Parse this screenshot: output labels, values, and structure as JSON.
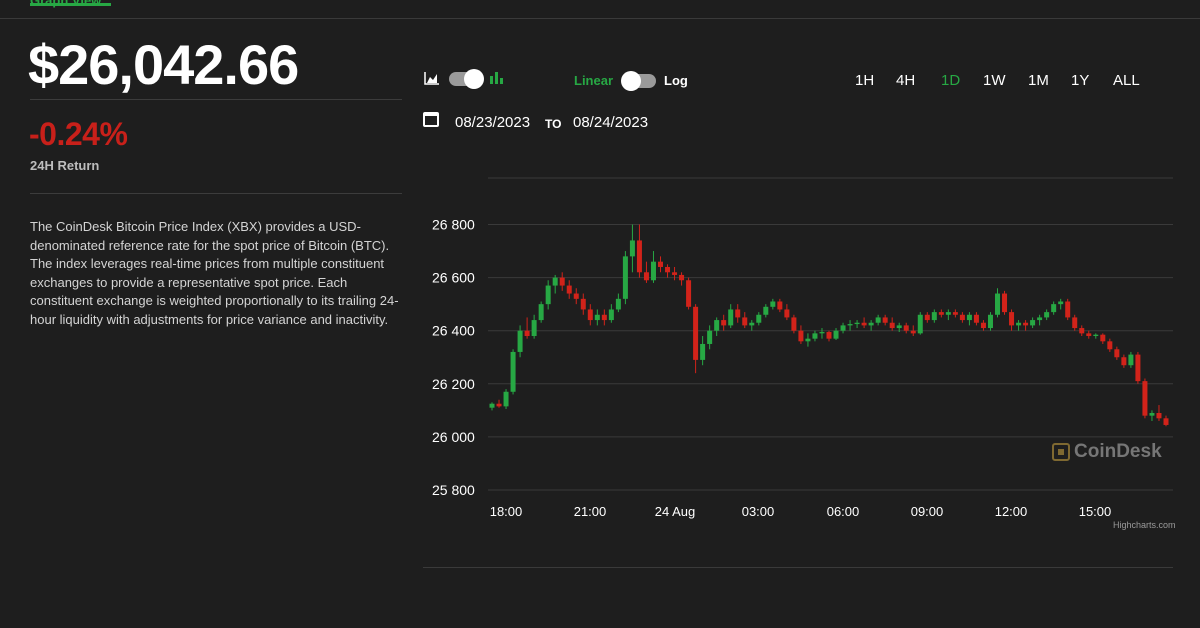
{
  "header": {
    "tab_label": "Graph View"
  },
  "summary": {
    "price": "$26,042.66",
    "change": "-0.24%",
    "change_label": "24H Return",
    "description": "The CoinDesk Bitcoin Price Index (XBX) provides a USD-denominated reference rate for the spot price of Bitcoin (BTC). The index leverages real-time prices from multiple constituent exchanges to provide a representative spot price. Each constituent exchange is weighted proportionally to its trailing 24-hour liquidity with adjustments for price variance and inactivity."
  },
  "controls": {
    "chart_style_icons": [
      "area-chart-icon",
      "candlestick-chart-icon"
    ],
    "scale_linear": "Linear",
    "scale_log": "Log",
    "ranges": [
      "1H",
      "4H",
      "1D",
      "1W",
      "1M",
      "1Y",
      "ALL"
    ],
    "active_range": "1D",
    "date_from": "08/23/2023",
    "date_to_label": "TO",
    "date_to": "08/24/2023"
  },
  "colors": {
    "up": "#27a844",
    "down": "#d2231a",
    "accent": "#27a844"
  },
  "chart_data": {
    "type": "candlestick",
    "x_ticks": [
      "18:00",
      "21:00",
      "24 Aug",
      "03:00",
      "06:00",
      "09:00",
      "12:00",
      "15:00"
    ],
    "y_ticks": [
      25800,
      26000,
      26200,
      26400,
      26600,
      26800
    ],
    "y_tick_labels": [
      "25 800",
      "26 000",
      "26 200",
      "26 400",
      "26 600",
      "26 800"
    ],
    "ylim": [
      25800,
      26850
    ],
    "grid": true,
    "credits": "Highcharts.com",
    "watermark": "CoinDesk",
    "candles": [
      [
        26110,
        26130,
        26100,
        26125
      ],
      [
        26125,
        26140,
        26110,
        26115
      ],
      [
        26115,
        26180,
        26105,
        26170
      ],
      [
        26170,
        26330,
        26160,
        26320
      ],
      [
        26320,
        26420,
        26300,
        26400
      ],
      [
        26400,
        26450,
        26370,
        26380
      ],
      [
        26380,
        26460,
        26370,
        26440
      ],
      [
        26440,
        26510,
        26430,
        26500
      ],
      [
        26500,
        26590,
        26480,
        26570
      ],
      [
        26570,
        26610,
        26540,
        26600
      ],
      [
        26600,
        26620,
        26550,
        26570
      ],
      [
        26570,
        26590,
        26520,
        26540
      ],
      [
        26540,
        26560,
        26500,
        26520
      ],
      [
        26520,
        26540,
        26460,
        26480
      ],
      [
        26480,
        26500,
        26420,
        26440
      ],
      [
        26440,
        26480,
        26420,
        26460
      ],
      [
        26460,
        26480,
        26420,
        26440
      ],
      [
        26440,
        26500,
        26430,
        26480
      ],
      [
        26480,
        26540,
        26470,
        26520
      ],
      [
        26520,
        26700,
        26500,
        26680
      ],
      [
        26680,
        26800,
        26620,
        26740
      ],
      [
        26740,
        26800,
        26600,
        26620
      ],
      [
        26620,
        26660,
        26580,
        26590
      ],
      [
        26590,
        26700,
        26580,
        26660
      ],
      [
        26660,
        26680,
        26620,
        26640
      ],
      [
        26640,
        26650,
        26600,
        26620
      ],
      [
        26620,
        26640,
        26590,
        26610
      ],
      [
        26610,
        26620,
        26570,
        26590
      ],
      [
        26590,
        26600,
        26480,
        26490
      ],
      [
        26490,
        26500,
        26240,
        26290
      ],
      [
        26290,
        26380,
        26270,
        26350
      ],
      [
        26350,
        26420,
        26330,
        26400
      ],
      [
        26400,
        26450,
        26380,
        26440
      ],
      [
        26440,
        26460,
        26400,
        26420
      ],
      [
        26420,
        26500,
        26410,
        26480
      ],
      [
        26480,
        26500,
        26430,
        26450
      ],
      [
        26450,
        26470,
        26410,
        26420
      ],
      [
        26420,
        26440,
        26400,
        26430
      ],
      [
        26430,
        26470,
        26420,
        26460
      ],
      [
        26460,
        26500,
        26450,
        26490
      ],
      [
        26490,
        26520,
        26480,
        26510
      ],
      [
        26510,
        26520,
        26470,
        26480
      ],
      [
        26480,
        26500,
        26440,
        26450
      ],
      [
        26450,
        26460,
        26390,
        26400
      ],
      [
        26400,
        26420,
        26350,
        26360
      ],
      [
        26360,
        26390,
        26340,
        26370
      ],
      [
        26370,
        26400,
        26360,
        26390
      ],
      [
        26390,
        26410,
        26370,
        26395
      ],
      [
        26395,
        26400,
        26360,
        26370
      ],
      [
        26370,
        26410,
        26365,
        26400
      ],
      [
        26400,
        26430,
        26390,
        26420
      ],
      [
        26420,
        26440,
        26400,
        26425
      ],
      [
        26425,
        26440,
        26410,
        26430
      ],
      [
        26430,
        26450,
        26410,
        26420
      ],
      [
        26420,
        26440,
        26400,
        26430
      ],
      [
        26430,
        26460,
        26420,
        26450
      ],
      [
        26450,
        26460,
        26420,
        26430
      ],
      [
        26430,
        26450,
        26400,
        26410
      ],
      [
        26410,
        26430,
        26395,
        26420
      ],
      [
        26420,
        26430,
        26390,
        26400
      ],
      [
        26400,
        26420,
        26380,
        26390
      ],
      [
        26390,
        26470,
        26385,
        26460
      ],
      [
        26460,
        26470,
        26430,
        26440
      ],
      [
        26440,
        26480,
        26430,
        26470
      ],
      [
        26470,
        26480,
        26450,
        26460
      ],
      [
        26460,
        26480,
        26440,
        26470
      ],
      [
        26470,
        26480,
        26450,
        26460
      ],
      [
        26460,
        26470,
        26430,
        26440
      ],
      [
        26440,
        26470,
        26420,
        26460
      ],
      [
        26460,
        26470,
        26420,
        26430
      ],
      [
        26430,
        26440,
        26400,
        26410
      ],
      [
        26410,
        26470,
        26400,
        26460
      ],
      [
        26460,
        26560,
        26450,
        26540
      ],
      [
        26540,
        26550,
        26460,
        26470
      ],
      [
        26470,
        26480,
        26400,
        26420
      ],
      [
        26420,
        26440,
        26400,
        26430
      ],
      [
        26430,
        26440,
        26400,
        26420
      ],
      [
        26420,
        26450,
        26410,
        26440
      ],
      [
        26440,
        26460,
        26420,
        26450
      ],
      [
        26450,
        26480,
        26440,
        26470
      ],
      [
        26470,
        26510,
        26460,
        26500
      ],
      [
        26500,
        26520,
        26480,
        26510
      ],
      [
        26510,
        26520,
        26440,
        26450
      ],
      [
        26450,
        26460,
        26400,
        26410
      ],
      [
        26410,
        26420,
        26380,
        26390
      ],
      [
        26390,
        26400,
        26370,
        26380
      ],
      [
        26380,
        26390,
        26370,
        26385
      ],
      [
        26385,
        26390,
        26350,
        26360
      ],
      [
        26360,
        26370,
        26320,
        26330
      ],
      [
        26330,
        26340,
        26290,
        26300
      ],
      [
        26300,
        26310,
        26260,
        26270
      ],
      [
        26270,
        26320,
        26260,
        26310
      ],
      [
        26310,
        26320,
        26200,
        26210
      ],
      [
        26210,
        26220,
        26070,
        26080
      ],
      [
        26080,
        26100,
        26060,
        26090
      ],
      [
        26090,
        26120,
        26060,
        26070
      ],
      [
        26070,
        26080,
        26040,
        26045
      ]
    ]
  }
}
